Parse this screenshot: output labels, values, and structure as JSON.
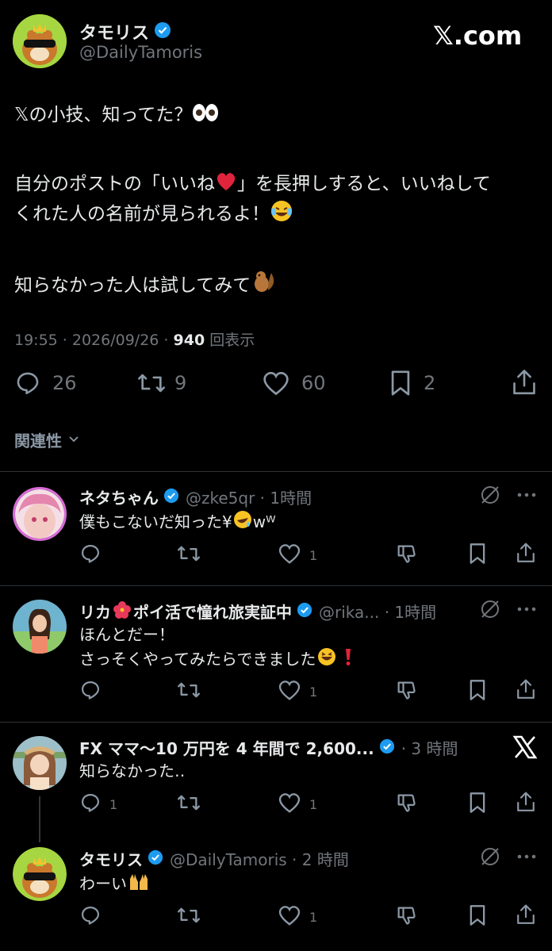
{
  "watermark": "𝕏.com",
  "main_post": {
    "author_name": "タモリス",
    "author_handle": "@DailyTamoris",
    "line1": "𝕏の小技、知ってた？",
    "line2a": "自分のポストの「いいね",
    "line2b": "」を長押しすると、いいねして",
    "line3": "くれた人の名前が見られるよ！",
    "line4": "知らなかった人は試してみて",
    "time": "19:55 · 2026/09/26 · ",
    "views_count": "940",
    "views_label": " 回表示",
    "replies": "26",
    "reposts": "9",
    "likes": "60",
    "bookmarks": "2",
    "related_label": "関連性"
  },
  "replies": [
    {
      "name": "ネタちゃん",
      "handle": "@zke5qr · 1時間",
      "text1": "僕もこないだ知った¥",
      "text1b": "wᵂ",
      "reply_count": "",
      "like_count": "1"
    },
    {
      "name": "リカ",
      "name2": "ポイ活で憧れ旅実証中",
      "handle": "@rika... · 1時間",
      "text1": "ほんとだー！",
      "text2": "さっそくやってみたらできました",
      "reply_count": "",
      "like_count": "1"
    },
    {
      "name": "FX ママ～10 万円を 4 年間で 2,600...",
      "handle": "· 3 時間",
      "text1": "知らなかった‥",
      "reply_count": "1",
      "like_count": "1"
    },
    {
      "name": "タモリス",
      "handle": "@DailyTamoris · 2 時間",
      "text1": "わーい",
      "reply_count": "",
      "like_count": "1"
    }
  ],
  "colors": {
    "background": "#000000",
    "text": "#e7e9ea",
    "muted": "#71767b",
    "verified": "#1d9bf0",
    "divider": "#2f3336"
  }
}
